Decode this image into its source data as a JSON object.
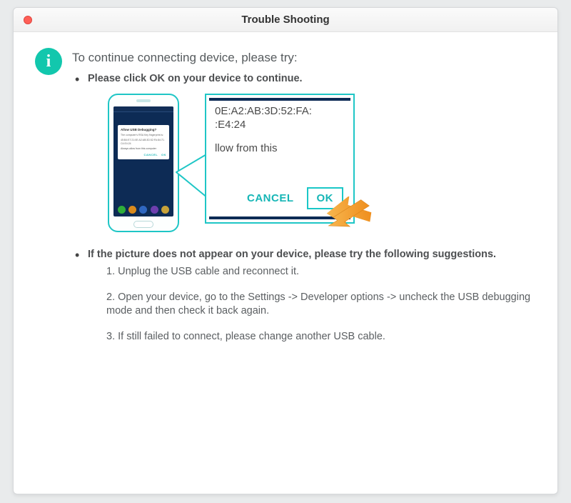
{
  "window": {
    "title": "Trouble Shooting"
  },
  "content": {
    "heading": "To continue connecting device, please try:",
    "bullet1": "Please click OK on your device to continue.",
    "bullet2": "If the picture does not appear on your device, please try the following suggestions.",
    "steps": {
      "s1": "1. Unplug the USB cable and reconnect it.",
      "s2": "2. Open your device, go to the Settings -> Developer options -> uncheck the USB debugging mode and then check it back again.",
      "s3": "3. If still failed to connect, please change another USB cable."
    }
  },
  "phone_dialog": {
    "title": "Allow USB Debugging?",
    "body_line1": "The computer's RSA Key fingerprint is:",
    "body_line2": "45:B4:E7:21:0E:A2:AB:3D:52:FA:84:71:C4:E4:24",
    "always": "Always allow from this computer",
    "cancel": "CANCEL",
    "ok": "OK"
  },
  "zoom": {
    "fp_line1": "0E:A2:AB:3D:52:FA:",
    "fp_line2": ":E4:24",
    "allow_fragment": "llow from this",
    "cancel": "CANCEL",
    "ok": "OK"
  },
  "colors": {
    "accent": "#1fc6c6",
    "close": "#ff5f57",
    "info_badge": "#12c7ad",
    "arrow": "#f5a623"
  }
}
